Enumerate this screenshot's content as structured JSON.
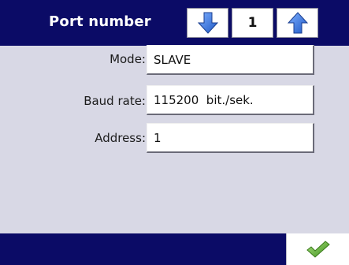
{
  "header": {
    "title": "Port number",
    "port_value": "1",
    "down_icon": "arrow-down-icon",
    "up_icon": "arrow-up-icon"
  },
  "fields": {
    "mode": {
      "label": "Mode:",
      "value": "SLAVE"
    },
    "baud_rate": {
      "label": "Baud rate:",
      "value": "115200  bit./sek."
    },
    "address": {
      "label": "Address:",
      "value": "1"
    }
  },
  "footer": {
    "confirm_icon": "checkmark-icon"
  },
  "colors": {
    "header_bg": "#0b0b66",
    "panel_bg": "#d8d8e5",
    "arrow_blue": "#2d6fd6",
    "check_green": "#5fb832"
  }
}
